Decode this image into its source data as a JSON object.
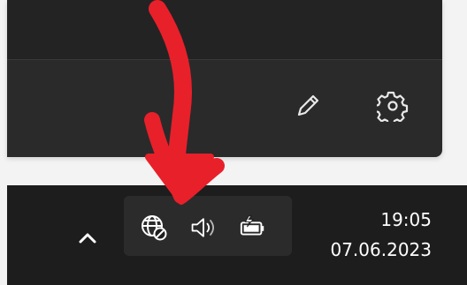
{
  "flyout": {
    "icons": {
      "edit": "pencil-icon",
      "settings": "gear-icon"
    }
  },
  "taskbar": {
    "show_hidden_icon": "chevron-up-icon",
    "tray_icons": [
      "globe-no-internet-icon",
      "speaker-icon",
      "battery-charging-icon"
    ],
    "time": "19:05",
    "date": "07.06.2023"
  },
  "annotation": {
    "arrow_color": "#e8202a"
  },
  "colors": {
    "taskbar_bg": "#1d1d1d",
    "flyout_bg": "#2a2a2a",
    "tray_hover": "#2b2b2b",
    "text": "#ffffff"
  }
}
